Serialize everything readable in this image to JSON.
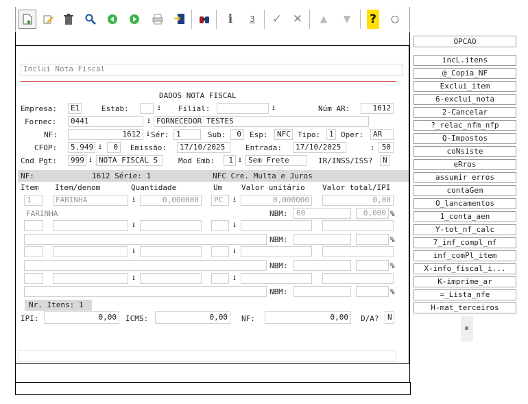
{
  "toolbar": {
    "icons": [
      "new-doc-icon",
      "edit-icon",
      "trash-icon",
      "search-icon",
      "prev-icon",
      "next-icon",
      "print-icon",
      "export-icon",
      "binoculars-icon",
      "info-icon",
      "count-icon",
      "check-icon",
      "tools-icon",
      "up-icon",
      "down-icon",
      "help-icon",
      "chat-icon"
    ]
  },
  "form": {
    "mode_text": "Inclui Nota Fiscal",
    "section_title": "DADOS NOTA FISCAL",
    "empresa_label": "Empresa:",
    "empresa_value": "E1",
    "estab_label": "Estab:",
    "estab_value": "",
    "filial_label": "Filial:",
    "filial_value": "",
    "num_ar_label": "Núm AR:",
    "num_ar_value": "1612",
    "fornec_label": "Fornec:",
    "fornec_code": "0441",
    "fornec_name": "FORNECEDOR TESTES",
    "nf_label": "NF:",
    "nf_value": "1612",
    "serie_label": "Sér:",
    "serie_value": "1",
    "sub_label": "Sub:",
    "sub_value": "0",
    "esp_label": "Esp:",
    "esp_value": "NFC",
    "tipo_label": "Tipo:",
    "tipo_value": "1",
    "oper_label": "Oper:",
    "oper_value": "AR",
    "cfop_label": "CFOP:",
    "cfop_value": "5.949",
    "cfop_seq": "0",
    "emissao_label": "Emissão:",
    "emissao_value": "17/10/2025",
    "entrada_label": "Entrada:",
    "entrada_value": "17/10/2025",
    "extra_label": ":",
    "extra_value": "50",
    "cndpgt_label": "Cnd Pgt:",
    "cndpgt_code": "999",
    "cndpgt_name": "NOTA FISCAL S",
    "modemb_label": "Mod Emb:",
    "modemb_code": "1",
    "modemb_name": "Sem Frete",
    "irinss_label": "IR/INSS/ISS?",
    "irinss_value": "N",
    "band_nf": "NF:",
    "band_num": "1612 Série: 1",
    "band_desc": "NFC Cre. Multa e Juros",
    "col_item": "Item",
    "col_denom": "Item/denom",
    "col_qtd": "Quantidade",
    "col_um": "Um",
    "col_vunit": "Valor unitário",
    "col_vtotal": "Valor total/IPI",
    "row1_item": "1",
    "row1_denom": "FARINHA",
    "row1_qtd": "0,000000",
    "row1_um": "PC",
    "row1_vunit": "0,000000",
    "row1_vtotal": "0,00",
    "row1_desc": "FARINHA",
    "nbm_label": "NBM:",
    "row1_nbm": "00",
    "row1_ipi": "0,000",
    "pct": "%",
    "nr_itens": "Nr. Itens: 1",
    "ipi_label": "IPI:",
    "ipi_value": "0,00",
    "icms_label": "ICMS:",
    "icms_value": "0,00",
    "nf_total_label": "NF:",
    "nf_total_value": "0,00",
    "da_label": "D/A?",
    "da_value": "N"
  },
  "options": {
    "header": "OPCAO",
    "items": [
      "incL.itens",
      "@_Copia_NF",
      "Exclui_item",
      "6-exclui_nota",
      "2-Cancelar",
      "?_relac_nfm_nfp",
      "Q-Impostos",
      "coNsiste",
      "eRros",
      "assumir erros",
      "contaGem",
      "O_lancamentos",
      "1_conta_aen",
      "Y-tot_nf_calc",
      "7_inf_compl_nf",
      "inf_comPl_item",
      "X-info_fiscal_i...",
      "K-imprime_ar",
      "=_Lista_nfe",
      "H-mat_terceiros"
    ]
  }
}
